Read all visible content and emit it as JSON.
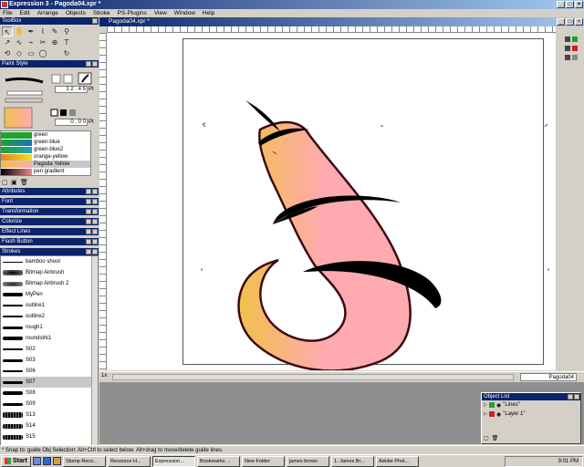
{
  "app": {
    "title": "Expression 3 - Pagoda04.xpr *"
  },
  "menu": [
    "File",
    "Edit",
    "Arrange",
    "Objects",
    "Stroke",
    "PS-Plugins",
    "View",
    "Window",
    "Help"
  ],
  "toolbox": {
    "title": "ToolBox",
    "tools": [
      "select-arrow",
      "hand",
      "pen",
      "brush",
      "pencil",
      "eyedropper",
      "zoom",
      "node-arrow",
      "bezier",
      "node-edit",
      "scissors",
      "text",
      "rotate",
      "skew",
      "rectangle",
      "ellipse",
      "reload",
      "blank"
    ]
  },
  "paint_style": {
    "title": "Paint Style",
    "width_value": "1 2 . 4 5",
    "width_unit": "Pt",
    "offset_value": "0 . 0 0",
    "offset_unit": "Pt",
    "swatches": [
      {
        "name": "green",
        "color": "#1fa32b"
      },
      {
        "name": "green-blue",
        "color": "#1a6fc0"
      },
      {
        "name": "green-blue2",
        "color": "#20a0c8"
      },
      {
        "name": "orange-yellow",
        "color": "#f0b020"
      },
      {
        "name": "Pagoda Yellow",
        "color": "#f2c040"
      },
      {
        "name": "pen gradient",
        "color": "#f08888"
      }
    ],
    "selected_swatch": "Pagoda Yellow"
  },
  "collapsed_panels": [
    "Attributes",
    "Font",
    "Transformation",
    "Colorize",
    "Effect Lines",
    "Flash Button"
  ],
  "strokes": {
    "title": "Strokes",
    "items": [
      "bamboo shoot",
      "Bitmap Airbrush",
      "Bitmap Airbrush 2",
      "MyPen",
      "outline1",
      "outline2",
      "rough1",
      "roundstrk1",
      "S02",
      "S03",
      "S06",
      "S07",
      "S08",
      "S09",
      "S13",
      "S14",
      "S15"
    ],
    "selected": "S07",
    "category": "rGeneral"
  },
  "document": {
    "title": "Pagoda04.xpr *",
    "zoom": "1x",
    "layer_field": "Pagoda04"
  },
  "object_list": {
    "title": "Object List",
    "layers": [
      {
        "name": "\"Lines\"",
        "color": "#1fa32b"
      },
      {
        "name": "\"Layer 1\"",
        "color": "#d02020"
      }
    ]
  },
  "status": {
    "text": "* Snap to: guide    Obj Selection: Alt+Ctrl to select below. Alt+drag to move/delete guide lines."
  },
  "taskbar": {
    "start": "Start",
    "tasks": [
      "Stomp Reco...",
      "Resource H...",
      "Expression...",
      "Bookmarks ...",
      "New Folder",
      "james brown",
      "1. James Br...",
      "Adobe Phot..."
    ],
    "active_task": "Expression...",
    "clock": "9:01 PM"
  },
  "colors": {
    "title_blue": "#0a246a",
    "gradient_start": "#f2c04a",
    "gradient_end": "#ffaab0",
    "outline": "#3a0a12"
  }
}
